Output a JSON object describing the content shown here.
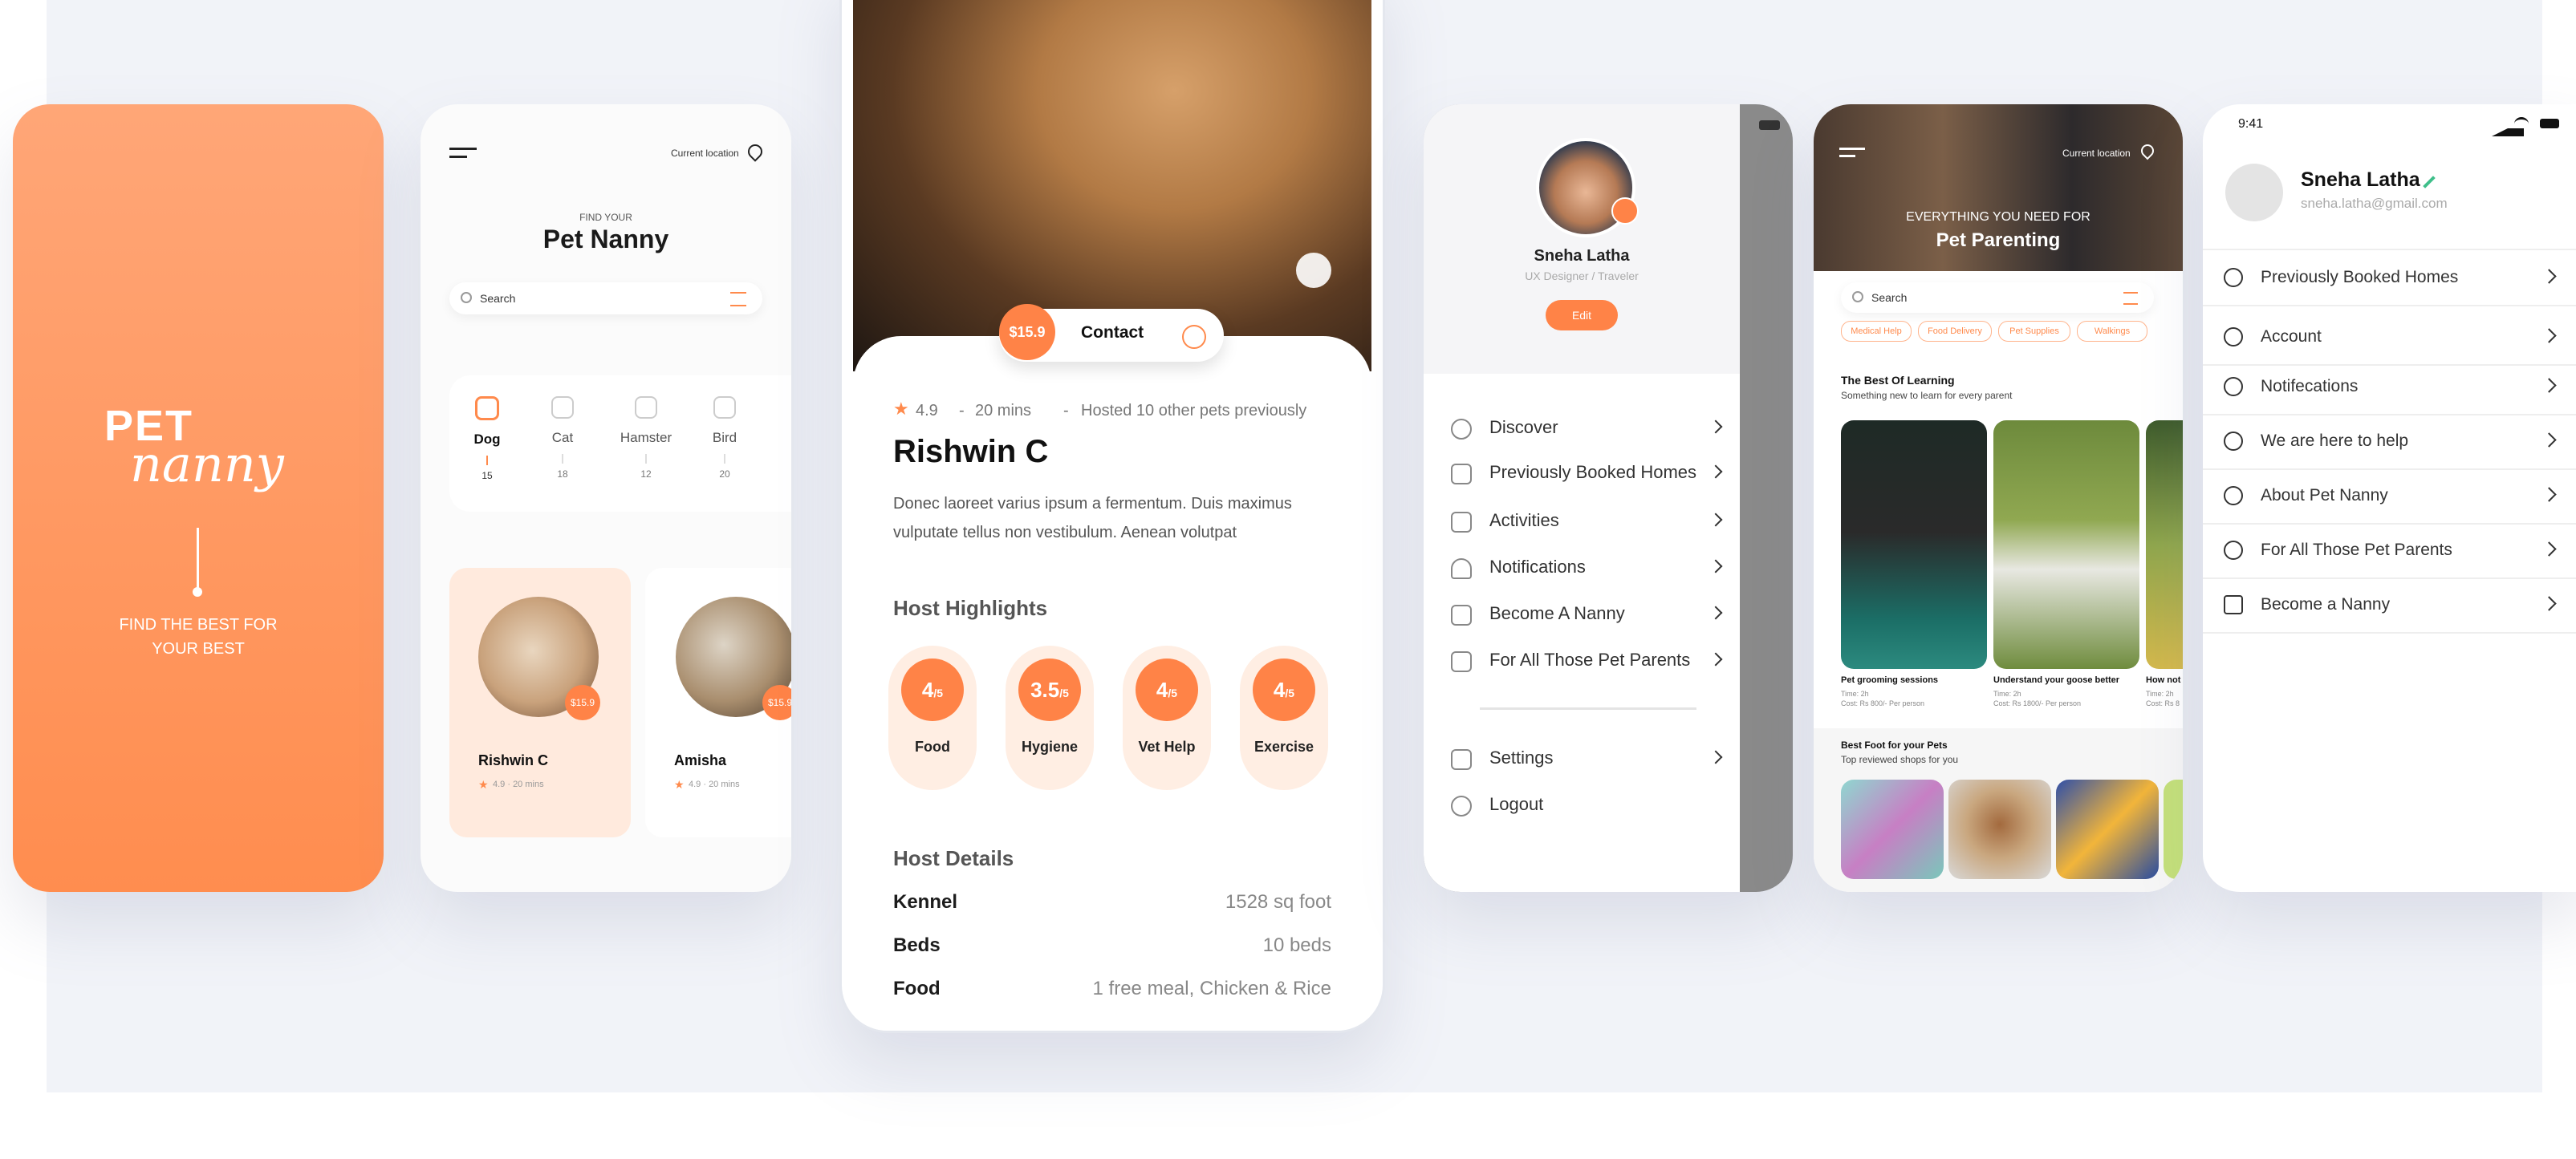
{
  "splash": {
    "logo_top": "PET",
    "logo_bottom": "nanny",
    "tagline_1": "FIND THE BEST FOR",
    "tagline_2": "YOUR BEST"
  },
  "find": {
    "location_label": "Current location",
    "subtitle": "FIND YOUR",
    "title": "Pet Nanny",
    "search_placeholder": "Search",
    "categories": [
      {
        "name": "Dog",
        "count": "15"
      },
      {
        "name": "Cat",
        "count": "18"
      },
      {
        "name": "Hamster",
        "count": "12"
      },
      {
        "name": "Bird",
        "count": "20"
      }
    ],
    "nannies": [
      {
        "name": "Rishwin C",
        "price": "$15.9",
        "meta": "4.9  ·  20 mins"
      },
      {
        "name": "Amisha",
        "price": "$15.9",
        "meta": "4.9  ·  20 mins"
      }
    ]
  },
  "detail": {
    "price": "$15.9",
    "contact_label": "Contact",
    "rating": "4.9",
    "time": "20 mins",
    "hosted": "Hosted 10 other pets previously",
    "name": "Rishwin C",
    "description_1": "Donec laoreet varius ipsum a fermentum. Duis maximus",
    "description_2": "vulputate tellus non vestibulum. Aenean volutpat",
    "highlights_heading": "Host Highlights",
    "highlights": [
      {
        "score": "4",
        "unit": "/5",
        "label": "Food"
      },
      {
        "score": "3.5",
        "unit": "/5",
        "label": "Hygiene"
      },
      {
        "score": "4",
        "unit": "/5",
        "label": "Vet Help"
      },
      {
        "score": "4",
        "unit": "/5",
        "label": "Exercise"
      }
    ],
    "details_heading": "Host Details",
    "details": [
      {
        "k": "Kennel",
        "v": "1528 sq foot"
      },
      {
        "k": "Beds",
        "v": "10 beds"
      },
      {
        "k": "Food",
        "v": "1 free meal, Chicken & Rice"
      }
    ]
  },
  "menu": {
    "user_name": "Sneha Latha",
    "user_role": "UX Designer / Traveler",
    "edit_label": "Edit",
    "items": [
      "Discover",
      "Previously Booked Homes",
      "Activities",
      "Notifications",
      "Become A Nanny",
      "For All Those Pet Parents"
    ],
    "settings_label": "Settings",
    "logout_label": "Logout"
  },
  "parent": {
    "location_label": "Current location",
    "hero_sub": "EVERYTHING YOU NEED FOR",
    "hero_title": "Pet Parenting",
    "search_placeholder": "Search",
    "chips": [
      "Medical Help",
      "Food Delivery",
      "Pet Supplies",
      "Walkings"
    ],
    "learning_title": "The Best Of Learning",
    "learning_sub": "Something new to learn for every parent",
    "learning": [
      {
        "title": "Pet grooming sessions",
        "time": "Time: 2h",
        "cost": "Cost: Rs 800/- Per person"
      },
      {
        "title": "Understand your goose better",
        "time": "Time: 2h",
        "cost": "Cost: Rs 1800/- Per person"
      },
      {
        "title": "How not",
        "time": "Time: 2h",
        "cost": "Cost: Rs 8"
      }
    ],
    "food_title": "Best Foot for your Pets",
    "food_sub": "Top reviewed shops for you"
  },
  "settings": {
    "time": "9:41",
    "name": "Sneha Latha",
    "email": "sneha.latha@gmail.com",
    "items": [
      "Previously Booked Homes",
      "Account",
      "Notifecations",
      "We are here to help",
      "About Pet Nanny",
      "For All Those Pet Parents",
      "Become a Nanny"
    ]
  },
  "colors": {
    "accent": "#ff8a4c",
    "accent_soft": "#ffeee3",
    "stage": "#f1f3f8"
  }
}
